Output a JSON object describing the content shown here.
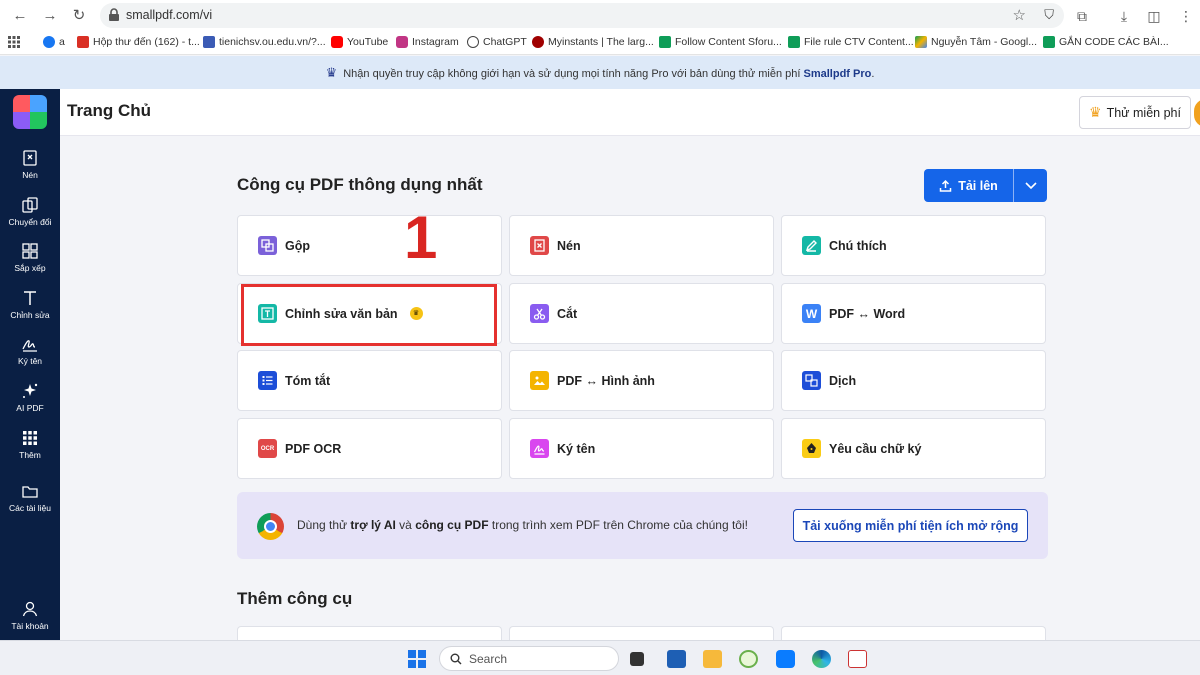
{
  "browser": {
    "url": "smallpdf.com/vi",
    "bookmarks": [
      {
        "label": "a",
        "color": "#1877f2"
      },
      {
        "label": "Hộp thư đến (162) - t...",
        "color": "#d93025"
      },
      {
        "label": "tienichsv.ou.edu.vn/?...",
        "color": "#3b5bb5"
      },
      {
        "label": "YouTube",
        "color": "#ff0000"
      },
      {
        "label": "Instagram",
        "color": "#c13584"
      },
      {
        "label": "ChatGPT",
        "color": "#444444"
      },
      {
        "label": "Myinstants | The larg...",
        "color": "#a00000"
      },
      {
        "label": "Follow Content Sforu...",
        "color": "#0f9d58"
      },
      {
        "label": "File rule CTV Content...",
        "color": "#0f9d58"
      },
      {
        "label": "Nguyễn Tâm - Googl...",
        "color": "#f4b400"
      },
      {
        "label": "GẮN CODE CÁC BÀI...",
        "color": "#0f9d58"
      }
    ]
  },
  "promo": {
    "text_before": "Nhận quyền truy cập không giới hạn và sử dụng mọi tính năng Pro với bản dùng thử miễn phí",
    "brand": "Smallpdf Pro",
    "text_after": "."
  },
  "sidebar": {
    "items": [
      {
        "label": "Nén",
        "icon": "compress-icon"
      },
      {
        "label": "Chuyển đổi",
        "icon": "convert-icon"
      },
      {
        "label": "Sắp xếp",
        "icon": "organize-icon"
      },
      {
        "label": "Chỉnh sửa",
        "icon": "edit-text-icon"
      },
      {
        "label": "Ký tên",
        "icon": "sign-icon"
      },
      {
        "label": "AI PDF",
        "icon": "sparkle-icon"
      },
      {
        "label": "Thêm",
        "icon": "grid-icon"
      },
      {
        "label": "Các tài liệu",
        "icon": "folder-icon"
      },
      {
        "label": "Tài khoản",
        "icon": "user-icon"
      }
    ]
  },
  "header": {
    "title": "Trang Chủ",
    "trial_label": "Thử miễn phí"
  },
  "main": {
    "section_title": "Công cụ PDF thông dụng nhất",
    "upload_label": "Tải lên",
    "tools": [
      {
        "label": "Gộp",
        "color": "#7b61d9"
      },
      {
        "label": "Nén",
        "color": "#e04848"
      },
      {
        "label": "Chú thích",
        "color": "#14b8a6"
      },
      {
        "label": "Chỉnh sửa văn bản",
        "color": "#14b8a6",
        "pro": true
      },
      {
        "label": "Cắt",
        "color": "#8a5cf0"
      },
      {
        "label": "PDF ↔ Word",
        "color": "#3b82f6"
      },
      {
        "label": "Tóm tắt",
        "color": "#1d4ed8"
      },
      {
        "label": "PDF ↔ Hình ảnh",
        "color": "#f4b400"
      },
      {
        "label": "Dịch",
        "color": "#1d4ed8"
      },
      {
        "label": "PDF OCR",
        "color": "#e04848",
        "badge": "OCR"
      },
      {
        "label": "Ký tên",
        "color": "#d946ef"
      },
      {
        "label": "Yêu cầu chữ ký",
        "color": "#facc15"
      }
    ],
    "annotation_number": "1",
    "chrome_promo": {
      "t1": "Dùng thử ",
      "b1": "trợ lý AI",
      "t2": " và ",
      "b2": "công cụ PDF",
      "t3": " trong trình xem PDF trên Chrome của chúng tôi!",
      "button": "Tải xuống miễn phí tiện ích mở rộng"
    },
    "section_title_2": "Thêm công cụ"
  },
  "taskbar": {
    "search_placeholder": "Search"
  }
}
